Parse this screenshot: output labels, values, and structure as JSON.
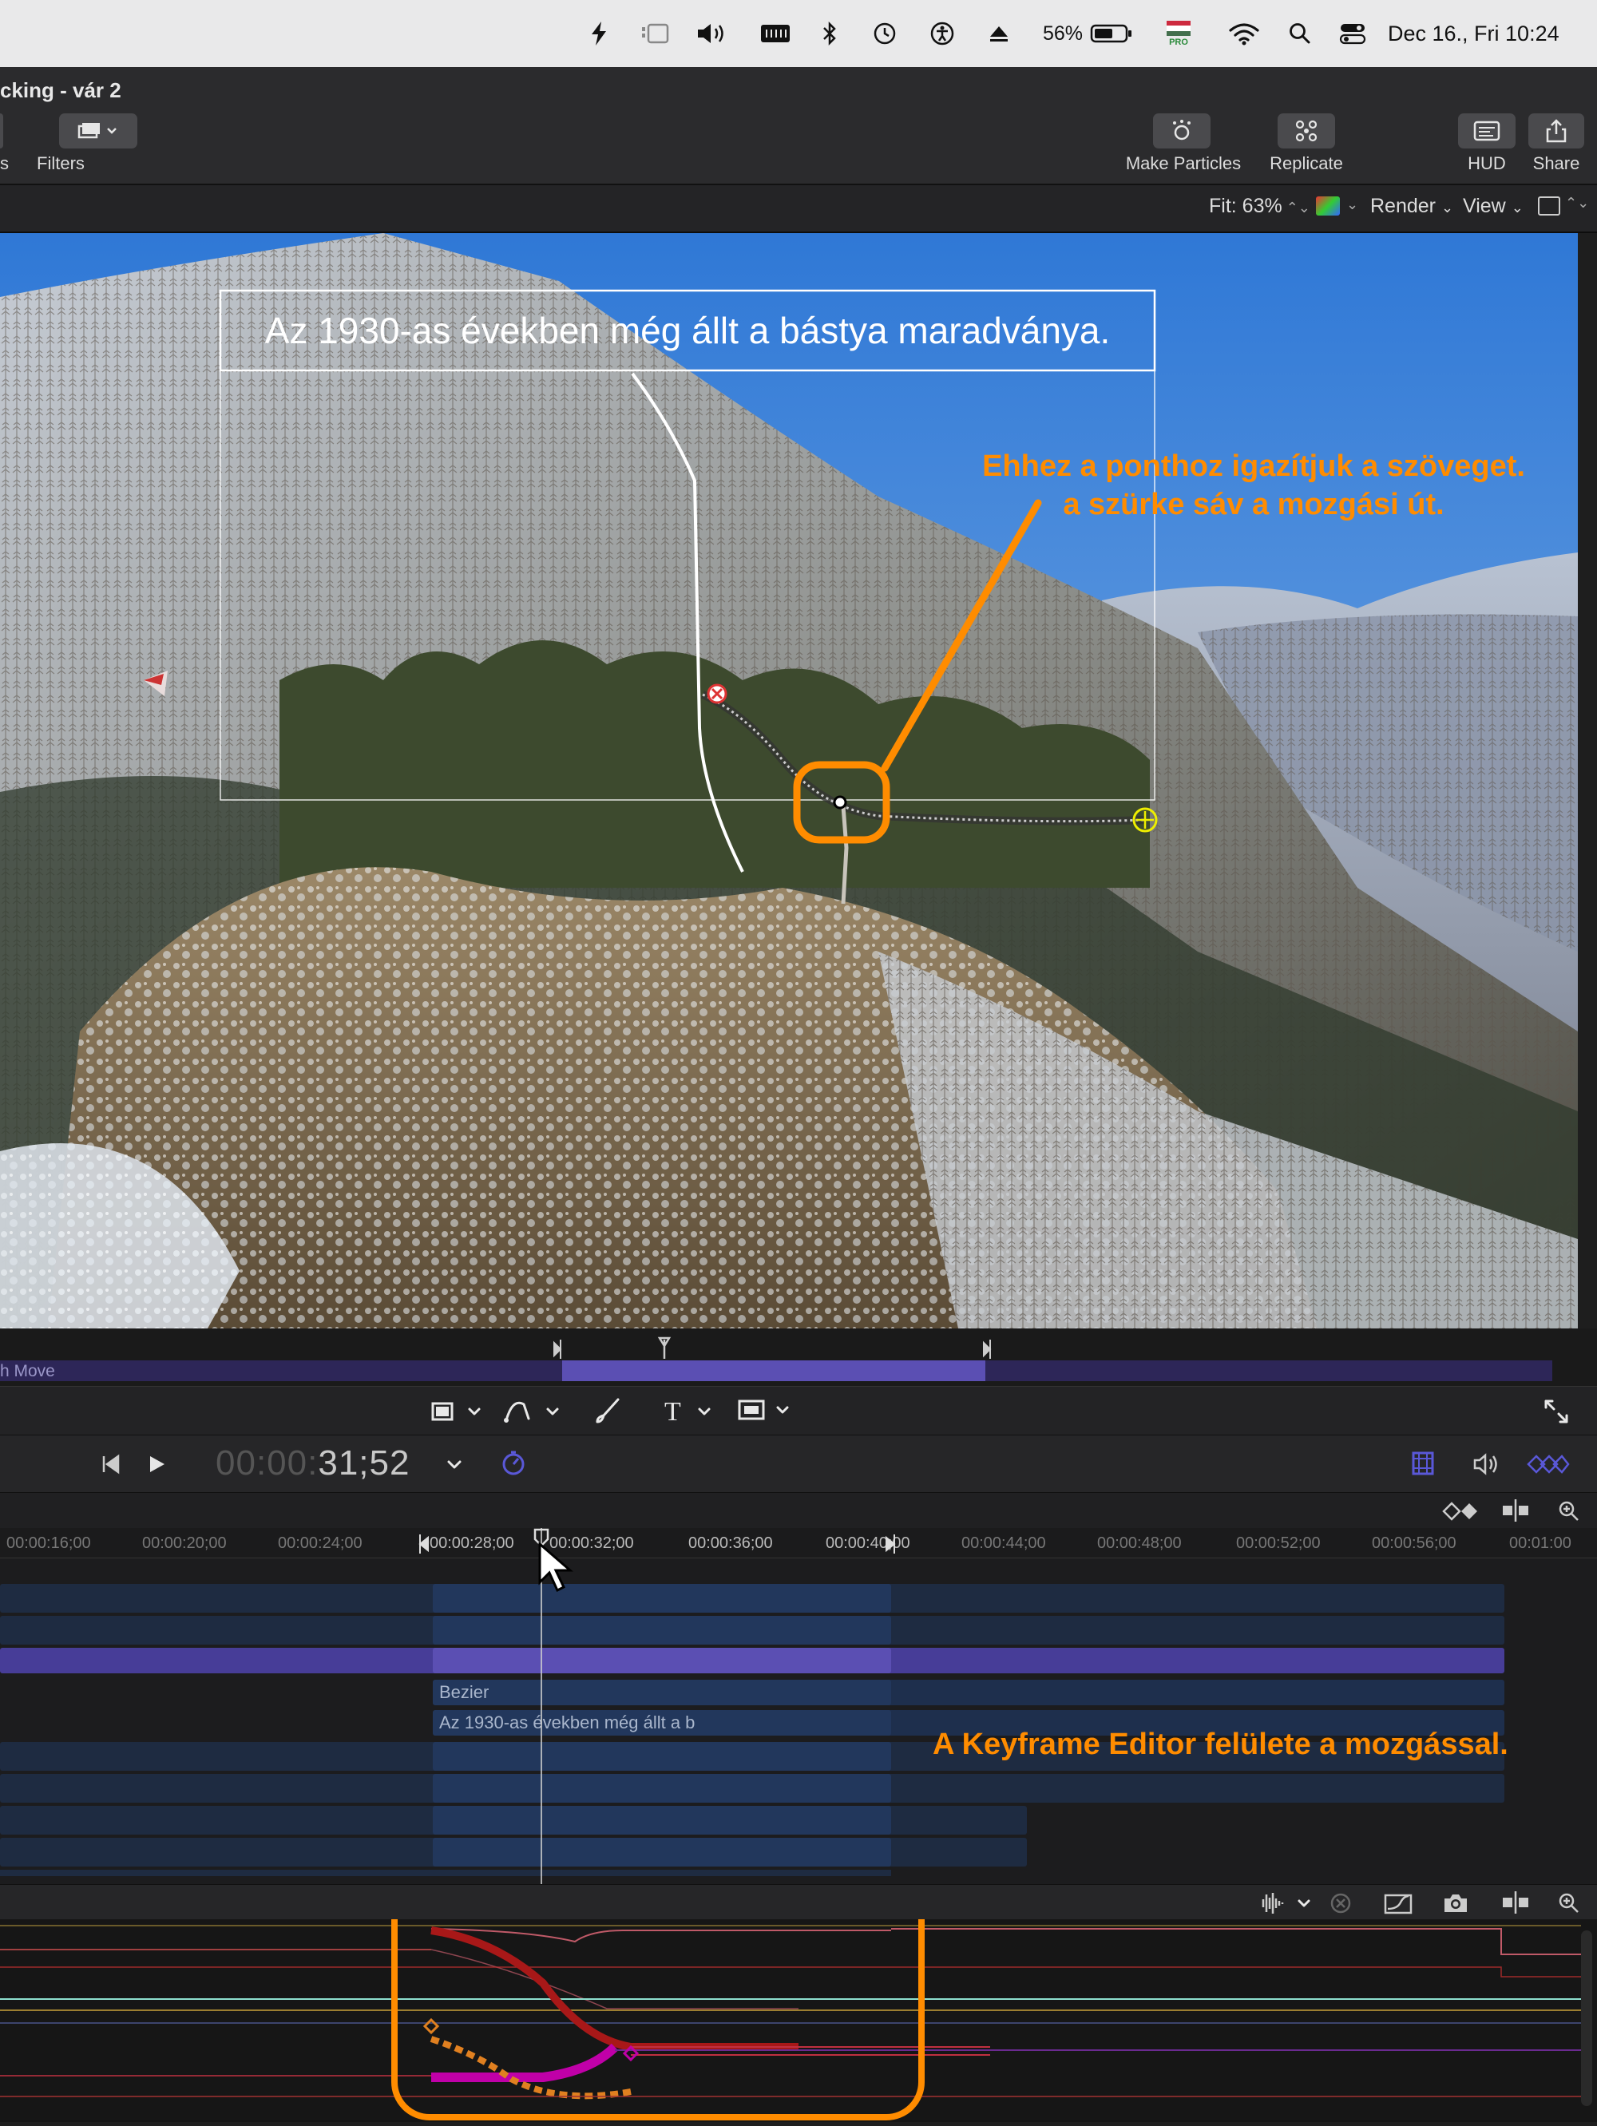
{
  "menubar": {
    "battery_pct": "56%",
    "datetime": "Dec 16., Fri  10:24",
    "flag_badge": "PRO"
  },
  "window": {
    "title": "cking - vár 2"
  },
  "toolbar": {
    "left_partial_label": "s",
    "filters_label": "Filters",
    "make_particles_label": "Make Particles",
    "replicate_label": "Replicate",
    "hud_label": "HUD",
    "share_label": "Share"
  },
  "viewbar": {
    "fit_label": "Fit: 63%",
    "render_label": "Render",
    "view_label": "View"
  },
  "canvas": {
    "text_layer": "Az 1930-as években még állt a bástya maradványa.",
    "annotation_top_line1": "Ehhez a ponthoz igazítjuk a szöveget.",
    "annotation_top_line2": "a szürke sáv a mozgási út."
  },
  "mini_timeline": {
    "label": "h Move"
  },
  "transport": {
    "timecode_dim": "00:00:",
    "timecode_bright": "31;52"
  },
  "ruler": {
    "ticks": [
      "00:00:16;00",
      "00:00:20;00",
      "00:00:24;00",
      "00:00:28;00",
      "00:00:32;00",
      "00:00:36;00",
      "00:00:40;00",
      "00:00:44;00",
      "00:00:48;00",
      "00:00:52;00",
      "00:00:56;00",
      "00:01:00"
    ]
  },
  "tracks": {
    "bezier_label": "Bezier",
    "text_label": "Az 1930-as években még állt a b"
  },
  "annotations": {
    "keyframe_note": "A Keyframe Editor felülete a mozgással."
  },
  "colors": {
    "accent_orange": "#ff8c00",
    "purple_bar": "#5b4fb3",
    "track_blue": "#1f3357"
  }
}
